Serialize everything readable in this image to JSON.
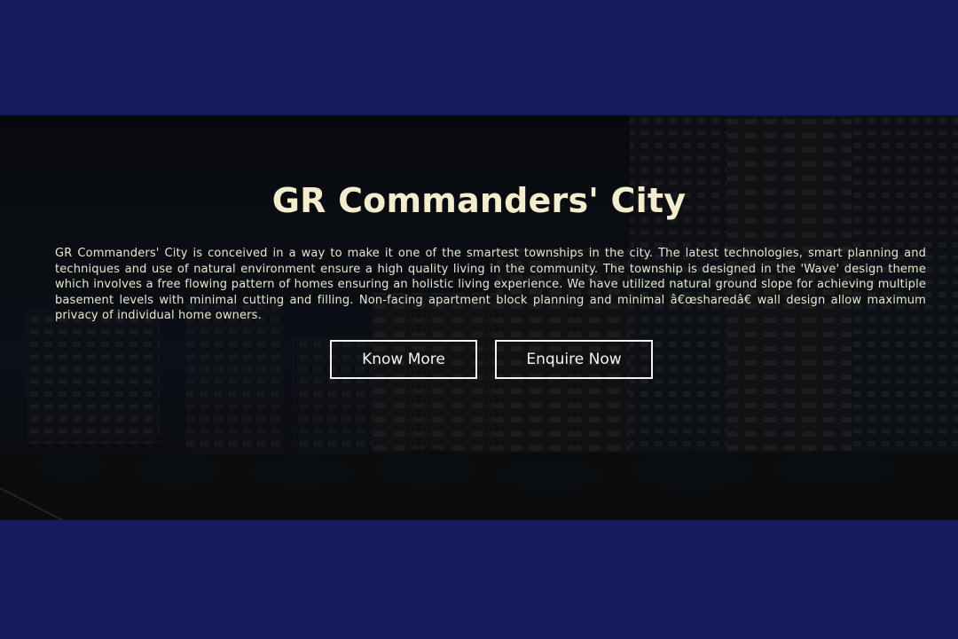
{
  "page": {
    "colors": {
      "background": "#15195e",
      "hero_overlay": "#0b0d10",
      "title": "#f3eccd",
      "text": "#ebe6d0",
      "button_border": "#f2f2f2"
    }
  },
  "hero": {
    "title": "GR Commanders' City",
    "description": "GR Commanders' City is conceived in a way to make it one of the smartest townships in the city. The latest technologies, smart planning and techniques and use of natural environment ensure a high quality living in the community. The township is designed in the 'Wave' design theme which involves a free flowing pattern of homes ensuring an holistic living experience. We have utilized natural ground slope for achieving multiple basement levels with minimal cutting and filling. Non-facing apartment block planning and minimal â€œsharedâ€ wall design allow maximum privacy of individual home owners.",
    "buttons": {
      "know_more": "Know More",
      "enquire_now": "Enquire Now"
    }
  }
}
